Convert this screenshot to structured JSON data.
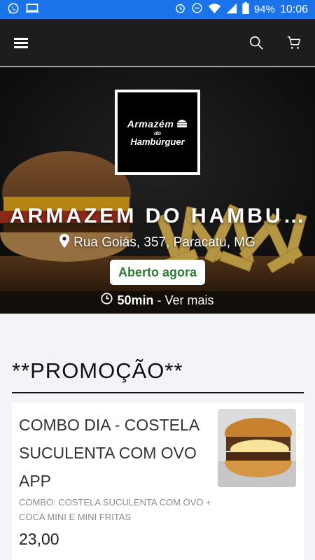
{
  "status_bar": {
    "battery": "94%",
    "time": "10:06",
    "icons": [
      "whatsapp-icon",
      "screen-icon",
      "alarm-icon",
      "dnd-icon",
      "wifi-icon",
      "signal-icon",
      "battery-icon"
    ]
  },
  "app_bar": {
    "icons": [
      "menu-icon",
      "search-icon",
      "cart-icon"
    ]
  },
  "logo": {
    "line1": "Armazém",
    "small": "do",
    "line2": "Hambúrguer"
  },
  "store": {
    "name": "ARMAZEM DO HAMBU...",
    "address": "Rua Goiás, 357, Paracatu, MG",
    "status": "Aberto agora",
    "eta_time": "50min",
    "eta_link": " - Ver mais"
  },
  "section": {
    "title": "**PROMOÇÃO**"
  },
  "product": {
    "title": "COMBO DIA - COSTELA SUCULENTA COM OVO APP",
    "description": "COMBO: COSTELA SUCULENTA COM OVO + COCA MINI E MINI FRITAS",
    "price": "23,00"
  },
  "colors": {
    "status_bar": "#1a73e8",
    "app_bar": "#1d1d1d",
    "open_text": "#2e7d32"
  }
}
